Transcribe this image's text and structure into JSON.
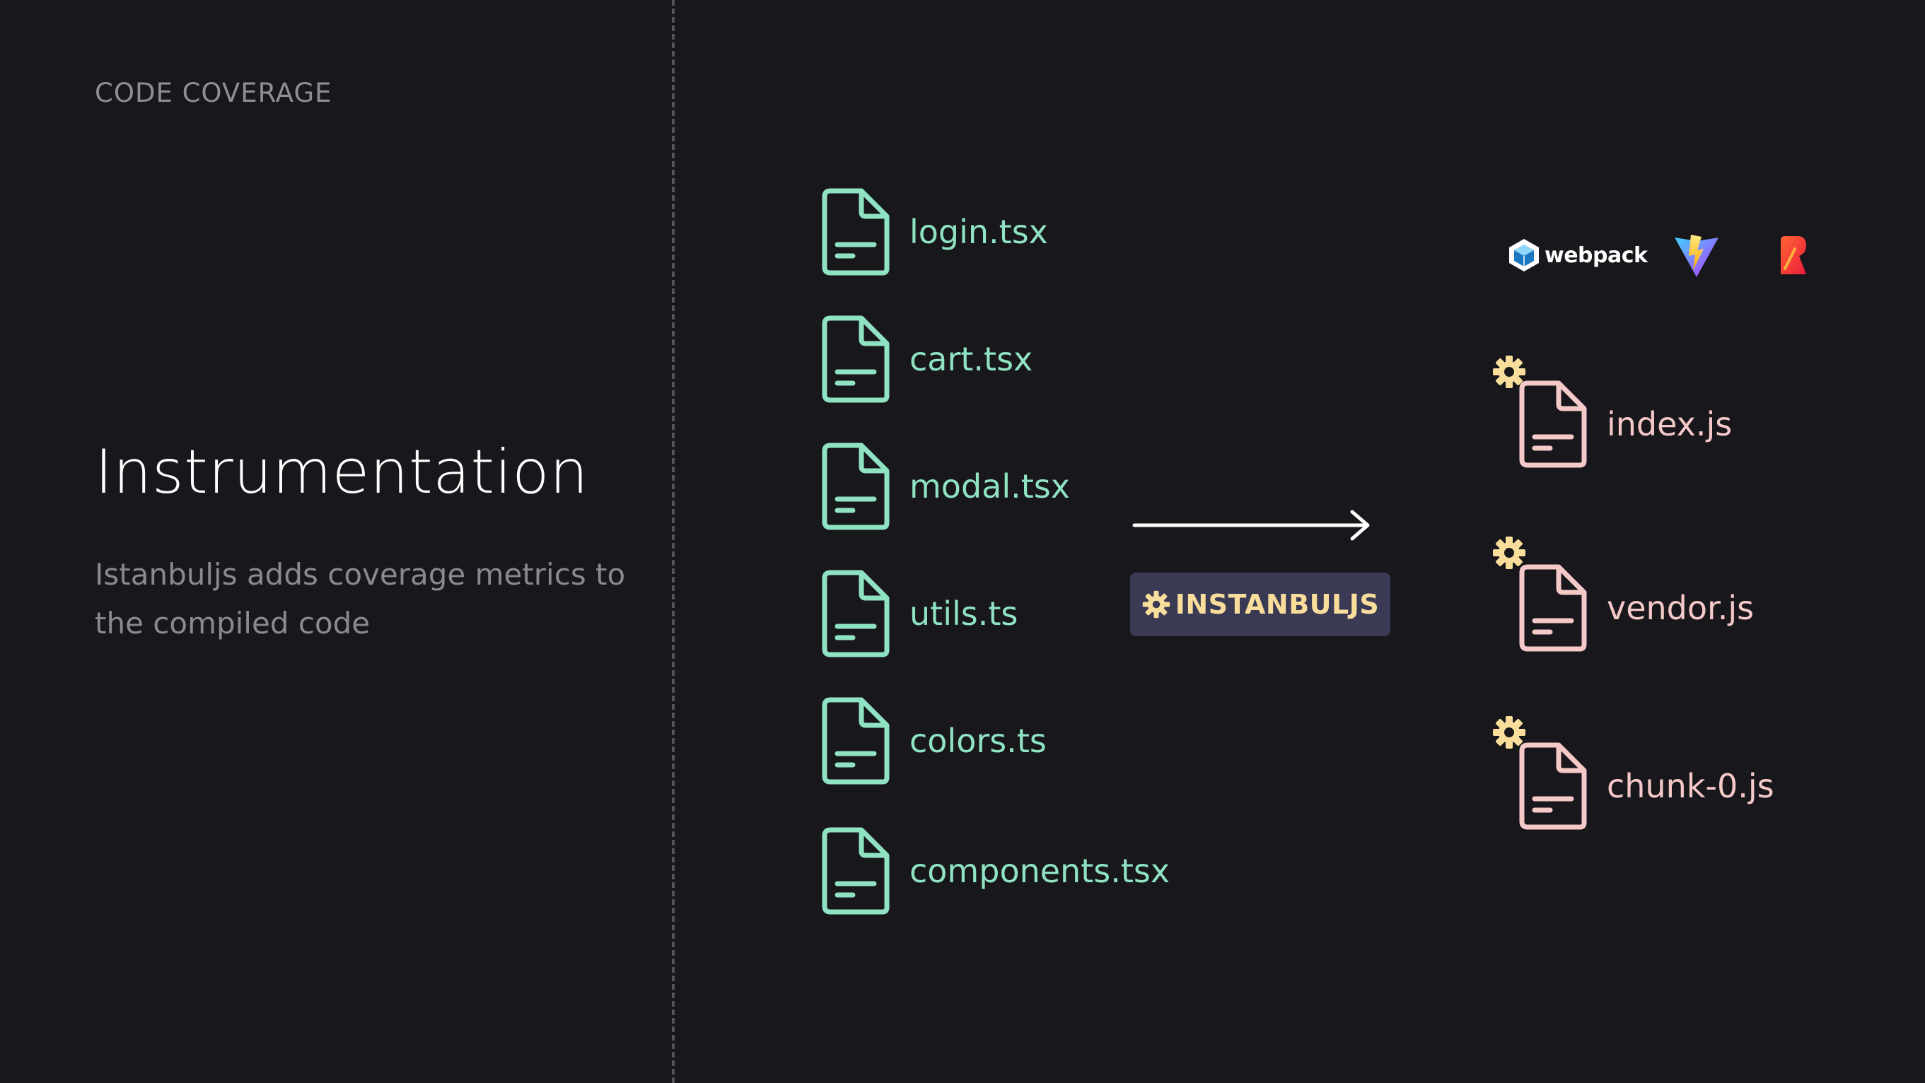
{
  "slide": {
    "eyebrow": "CODE COVERAGE",
    "title": "Instrumentation",
    "subtitle": "Istanbuljs adds coverage metrics to the compiled code"
  },
  "source_files": [
    {
      "name": "login.tsx"
    },
    {
      "name": "cart.tsx"
    },
    {
      "name": "modal.tsx"
    },
    {
      "name": "utils.ts"
    },
    {
      "name": "colors.ts"
    },
    {
      "name": "components.tsx"
    }
  ],
  "instrumenter": {
    "label": "INSTANBULJS",
    "icon": "gear-icon"
  },
  "bundlers": [
    {
      "name": "webpack",
      "icon": "webpack-logo"
    },
    {
      "name": "vite",
      "icon": "vite-logo"
    },
    {
      "name": "rollup",
      "icon": "rollup-logo"
    }
  ],
  "output_files": [
    {
      "name": "index.js"
    },
    {
      "name": "vendor.js"
    },
    {
      "name": "chunk-0.js"
    }
  ],
  "colors": {
    "background": "#18171c",
    "source_file": "#8fe3c2",
    "output_file": "#f6c9c9",
    "gear": "#f9dd9a",
    "badge_bg": "#3b3a55"
  }
}
